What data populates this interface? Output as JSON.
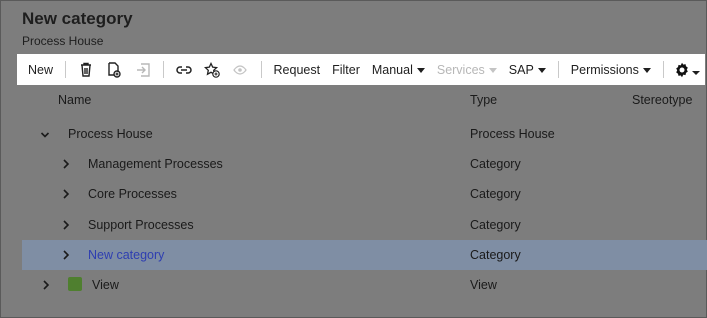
{
  "page": {
    "title": "New category",
    "subtitle": "Process House"
  },
  "toolbar": {
    "new_label": "New",
    "request_label": "Request",
    "filter_label": "Filter",
    "manual_label": "Manual",
    "services_label": "Services",
    "sap_label": "SAP",
    "permissions_label": "Permissions",
    "icons": [
      "trash-icon",
      "copy-document-icon",
      "move-icon",
      "link-icon",
      "star-add-icon",
      "eye-icon",
      "gear-icon"
    ]
  },
  "columns": {
    "name": "Name",
    "type": "Type",
    "stereotype": "Stereotype"
  },
  "tree": [
    {
      "label": "Process House",
      "type": "Process House",
      "expanded": true,
      "level": 0
    },
    {
      "label": "Management Processes",
      "type": "Category",
      "expanded": false,
      "level": 1
    },
    {
      "label": "Core Processes",
      "type": "Category",
      "expanded": false,
      "level": 1
    },
    {
      "label": "Support Processes",
      "type": "Category",
      "expanded": false,
      "level": 1
    },
    {
      "label": "New category",
      "type": "Category",
      "expanded": false,
      "level": 1,
      "selected": true
    },
    {
      "label": "View",
      "type": "View",
      "expanded": false,
      "level": 0,
      "icon": "green-square-icon"
    }
  ],
  "colors": {
    "overlay": "#7d7d7d",
    "selected_row": "#7f8ea4",
    "selected_text": "#2e3eb1",
    "view_icon": "#4f7f2f"
  }
}
